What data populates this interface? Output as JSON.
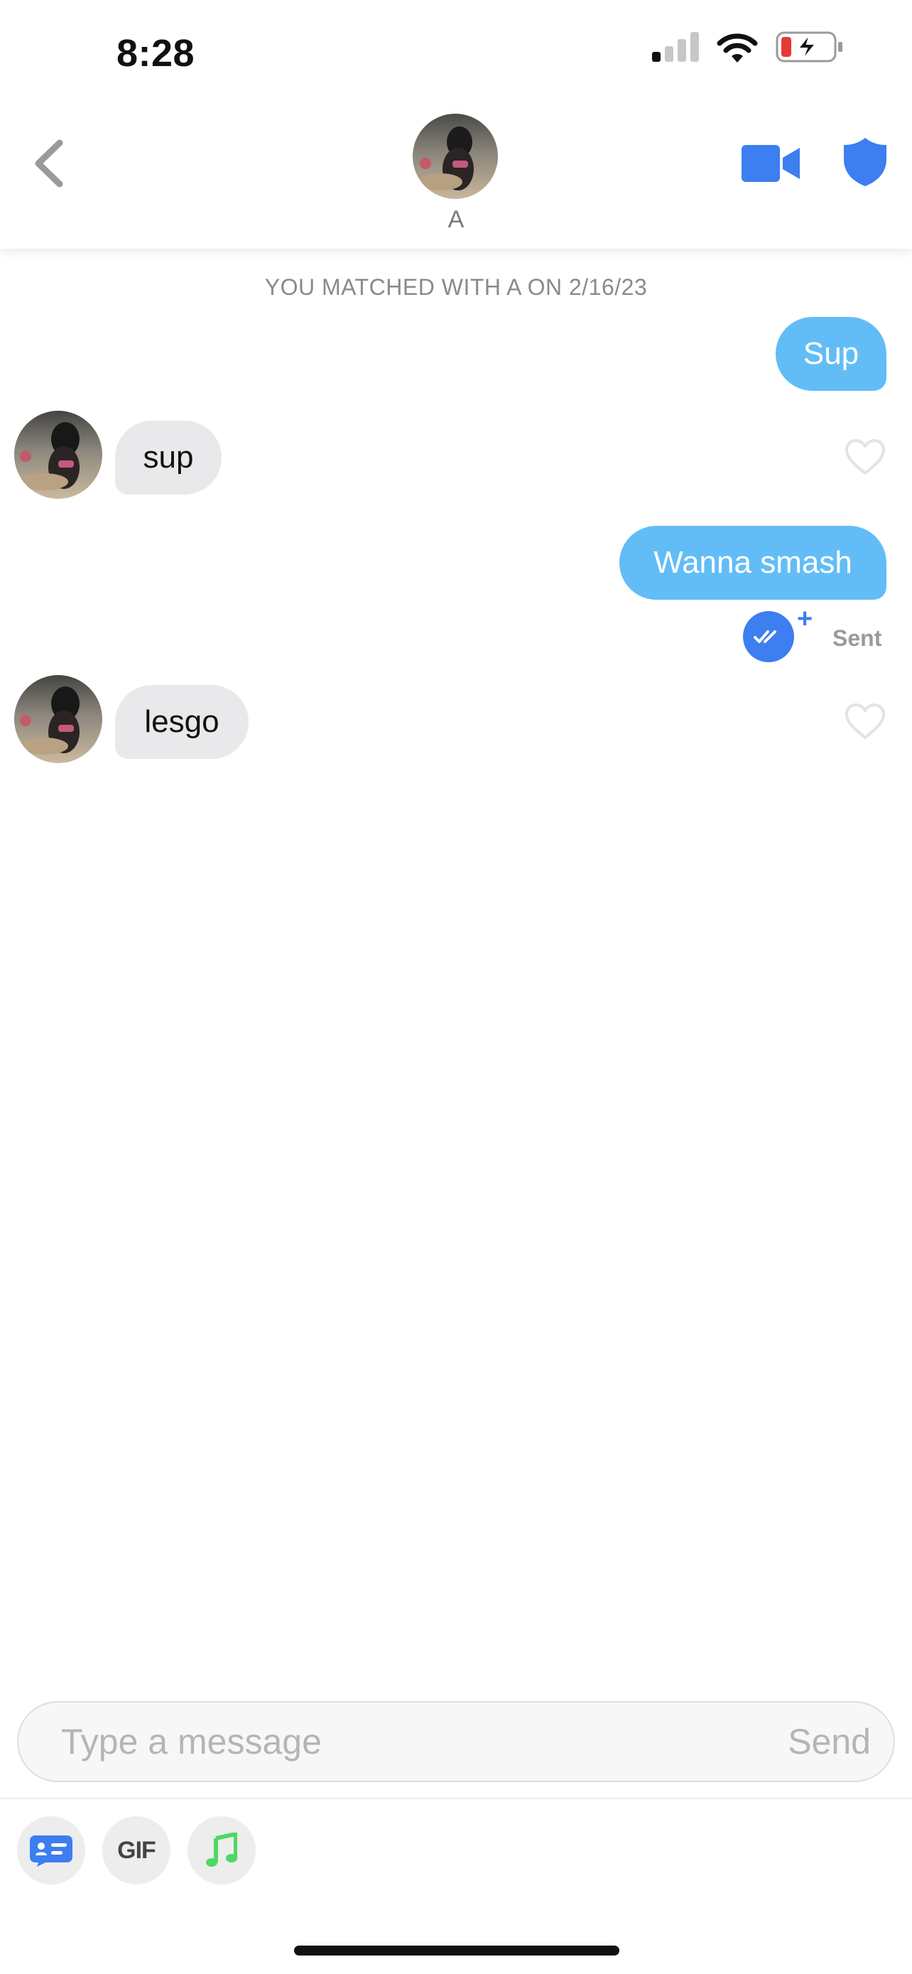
{
  "status_bar": {
    "time": "8:28",
    "icons": [
      "cellular-signal-icon",
      "wifi-icon",
      "battery-charging-icon"
    ]
  },
  "header": {
    "back_icon": "chevron-left-icon",
    "match_name": "A",
    "video_icon": "video-camera-icon",
    "safety_icon": "shield-icon"
  },
  "conversation": {
    "match_notice": "YOU MATCHED WITH A ON 2/16/23",
    "messages": [
      {
        "direction": "outgoing",
        "text": "Sup"
      },
      {
        "direction": "incoming",
        "text": "sup",
        "liked": false
      },
      {
        "direction": "outgoing",
        "text": "Wanna smash",
        "status": "Sent"
      },
      {
        "direction": "incoming",
        "text": "lesgo",
        "liked": false
      }
    ]
  },
  "composer": {
    "placeholder": "Type a message",
    "value": "",
    "send_label": "Send",
    "tools": [
      {
        "icon": "profile-card-icon"
      },
      {
        "label": "GIF"
      },
      {
        "icon": "music-note-icon"
      }
    ]
  },
  "colors": {
    "outgoing_bubble": "#62bdf6",
    "incoming_bubble": "#e9e9eb",
    "accent_blue": "#3d7ef0",
    "music_green": "#4cd964",
    "battery_low": "#e53935"
  }
}
